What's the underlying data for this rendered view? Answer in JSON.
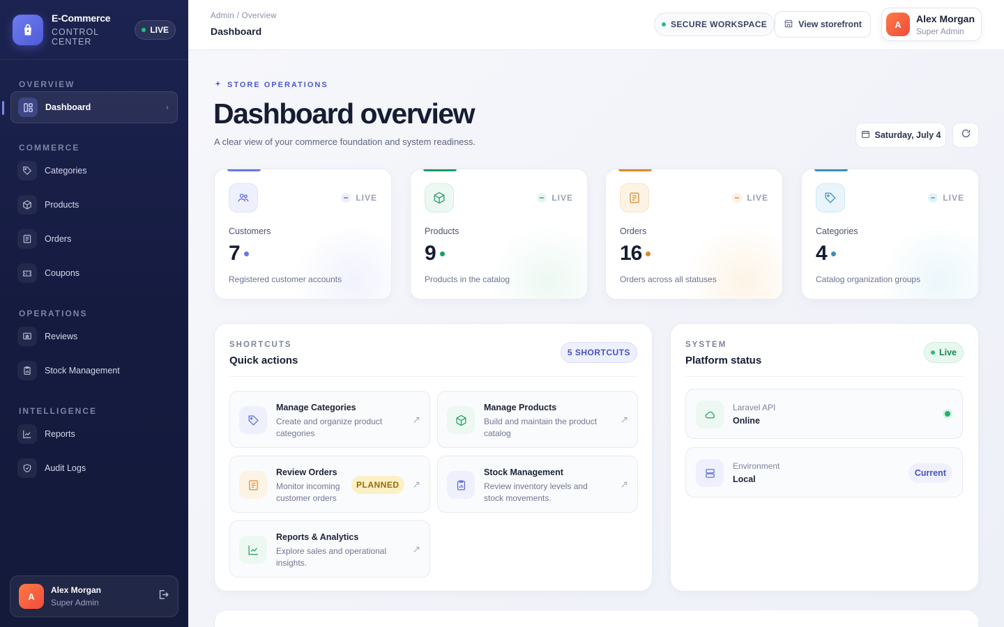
{
  "brand": {
    "title": "E-Commerce",
    "subtitle": "CONTROL CENTER",
    "live": "LIVE"
  },
  "sidebar": {
    "sections": [
      {
        "heading": "OVERVIEW",
        "items": [
          {
            "label": "Dashboard",
            "icon": "dashboard-grid-icon",
            "active": true
          }
        ]
      },
      {
        "heading": "COMMERCE",
        "items": [
          {
            "label": "Categories",
            "icon": "tag-icon"
          },
          {
            "label": "Products",
            "icon": "box-icon"
          },
          {
            "label": "Orders",
            "icon": "receipt-icon"
          },
          {
            "label": "Coupons",
            "icon": "ticket-icon"
          }
        ]
      },
      {
        "heading": "OPERATIONS",
        "items": [
          {
            "label": "Reviews",
            "icon": "review-shield-icon"
          },
          {
            "label": "Stock Management",
            "icon": "clipboard-chart-icon"
          }
        ]
      },
      {
        "heading": "INTELLIGENCE",
        "items": [
          {
            "label": "Reports",
            "icon": "line-chart-icon"
          },
          {
            "label": "Audit Logs",
            "icon": "shield-check-icon"
          }
        ]
      }
    ],
    "user": {
      "initial": "A",
      "name": "Alex Morgan",
      "role": "Super Admin"
    }
  },
  "topbar": {
    "breadcrumb": "Admin / Overview",
    "title": "Dashboard",
    "secure_label": "SECURE WORKSPACE",
    "storefront_label": "View storefront",
    "user": {
      "initial": "A",
      "name": "Alex Morgan",
      "role": "Super Admin"
    }
  },
  "hero": {
    "kicker": "STORE OPERATIONS",
    "title": "Dashboard overview",
    "lead": "A clear view of your commerce foundation and system readiness.",
    "date": "Saturday, July 4"
  },
  "stats": [
    {
      "label": "Customers",
      "value": "7",
      "desc": "Registered customer accounts",
      "live": "LIVE",
      "color": "#6b76e0",
      "icon": "users-icon"
    },
    {
      "label": "Products",
      "value": "9",
      "desc": "Products in the catalog",
      "live": "LIVE",
      "color": "#1f9a63",
      "icon": "box-icon"
    },
    {
      "label": "Orders",
      "value": "16",
      "desc": "Orders across all statuses",
      "live": "LIVE",
      "color": "#d9892b",
      "icon": "receipt-icon"
    },
    {
      "label": "Categories",
      "value": "4",
      "desc": "Catalog organization groups",
      "live": "LIVE",
      "color": "#3a8fb8",
      "icon": "tag-icon"
    }
  ],
  "shortcuts": {
    "kicker": "SHORTCUTS",
    "title": "Quick actions",
    "count": "5 SHORTCUTS",
    "items": [
      {
        "title": "Manage Categories",
        "desc": "Create and organize product categories",
        "icon": "tag-icon"
      },
      {
        "title": "Manage Products",
        "desc": "Build and maintain the product catalog",
        "icon": "box-icon"
      },
      {
        "title": "Review Orders",
        "desc": "Monitor incoming customer orders",
        "icon": "receipt-icon",
        "badge": "PLANNED"
      },
      {
        "title": "Stock Management",
        "desc": "Review inventory levels and stock movements.",
        "icon": "clipboard-chart-icon"
      },
      {
        "title": "Reports & Analytics",
        "desc": "Explore sales and operational insights.",
        "icon": "line-chart-icon"
      }
    ]
  },
  "system": {
    "kicker": "SYSTEM",
    "title": "Platform status",
    "status": "Live",
    "rows": [
      {
        "label": "Laravel API",
        "value": "Online",
        "icon": "cloud-icon"
      },
      {
        "label": "Environment",
        "value": "Local",
        "badge": "Current",
        "icon": "server-icon"
      }
    ]
  }
}
